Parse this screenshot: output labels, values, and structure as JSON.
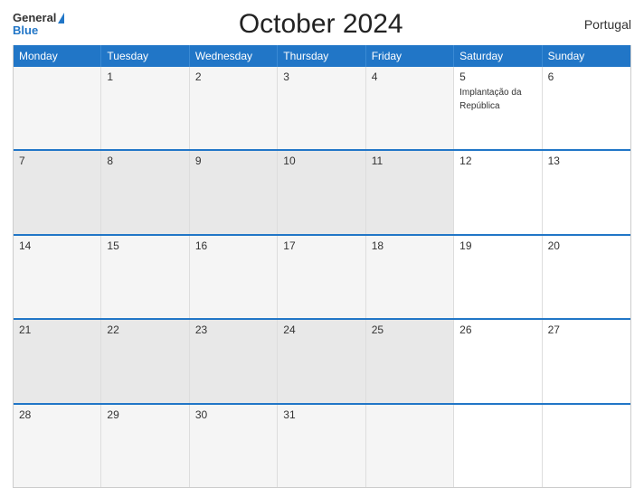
{
  "header": {
    "logo_general": "General",
    "logo_blue": "Blue",
    "title": "October 2024",
    "country": "Portugal"
  },
  "days_of_week": [
    "Monday",
    "Tuesday",
    "Wednesday",
    "Thursday",
    "Friday",
    "Saturday",
    "Sunday"
  ],
  "weeks": [
    [
      {
        "num": "",
        "event": ""
      },
      {
        "num": "1",
        "event": ""
      },
      {
        "num": "2",
        "event": ""
      },
      {
        "num": "3",
        "event": ""
      },
      {
        "num": "4",
        "event": ""
      },
      {
        "num": "5",
        "event": "Implantação da República"
      },
      {
        "num": "6",
        "event": ""
      }
    ],
    [
      {
        "num": "7",
        "event": ""
      },
      {
        "num": "8",
        "event": ""
      },
      {
        "num": "9",
        "event": ""
      },
      {
        "num": "10",
        "event": ""
      },
      {
        "num": "11",
        "event": ""
      },
      {
        "num": "12",
        "event": ""
      },
      {
        "num": "13",
        "event": ""
      }
    ],
    [
      {
        "num": "14",
        "event": ""
      },
      {
        "num": "15",
        "event": ""
      },
      {
        "num": "16",
        "event": ""
      },
      {
        "num": "17",
        "event": ""
      },
      {
        "num": "18",
        "event": ""
      },
      {
        "num": "19",
        "event": ""
      },
      {
        "num": "20",
        "event": ""
      }
    ],
    [
      {
        "num": "21",
        "event": ""
      },
      {
        "num": "22",
        "event": ""
      },
      {
        "num": "23",
        "event": ""
      },
      {
        "num": "24",
        "event": ""
      },
      {
        "num": "25",
        "event": ""
      },
      {
        "num": "26",
        "event": ""
      },
      {
        "num": "27",
        "event": ""
      }
    ],
    [
      {
        "num": "28",
        "event": ""
      },
      {
        "num": "29",
        "event": ""
      },
      {
        "num": "30",
        "event": ""
      },
      {
        "num": "31",
        "event": ""
      },
      {
        "num": "",
        "event": ""
      },
      {
        "num": "",
        "event": ""
      },
      {
        "num": "",
        "event": ""
      }
    ]
  ]
}
